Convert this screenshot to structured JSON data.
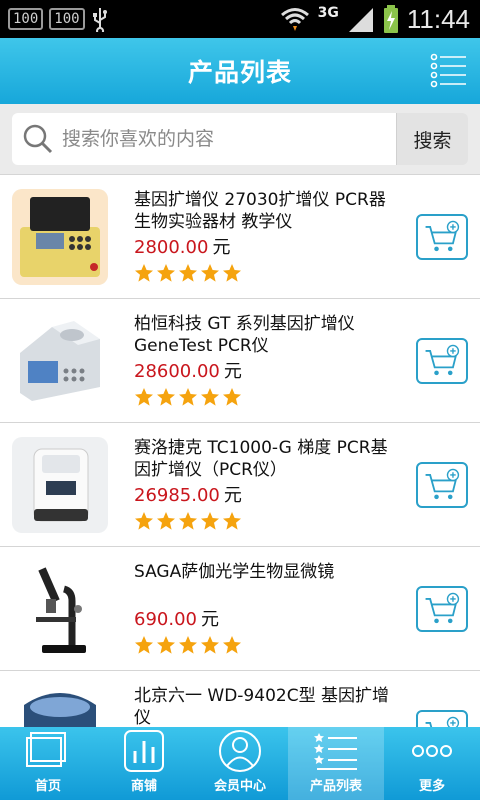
{
  "status_bar": {
    "left_boxes": [
      "100",
      "100"
    ],
    "network": "3G",
    "time": "11:44"
  },
  "header": {
    "title": "产品列表"
  },
  "search": {
    "placeholder": "搜索你喜欢的内容",
    "button_label": "搜索"
  },
  "products": [
    {
      "name": " 基因扩增仪 27030扩增仪 PCR器 生物实验器材 教学仪",
      "price": "2800.00",
      "unit": "元",
      "rating": 5
    },
    {
      "name": "柏恒科技 GT 系列基因扩增仪 GeneTest PCR仪",
      "price": "28600.00",
      "unit": "元",
      "rating": 5
    },
    {
      "name": "赛洛捷克 TC1000-G 梯度 PCR基因扩增仪（PCR仪）",
      "price": "26985.00",
      "unit": "元",
      "rating": 5
    },
    {
      "name": "SAGA萨伽光学生物显微镜",
      "price": "690.00",
      "unit": "元",
      "rating": 5
    },
    {
      "name": "北京六一 WD-9402C型 基因扩增仪",
      "price": "",
      "unit": "",
      "rating": 0
    }
  ],
  "tabs": [
    {
      "label": "首页",
      "icon": "home-icon"
    },
    {
      "label": "商铺",
      "icon": "shop-icon"
    },
    {
      "label": "会员中心",
      "icon": "member-icon"
    },
    {
      "label": "产品列表",
      "icon": "product-list-icon",
      "active": true
    },
    {
      "label": "更多",
      "icon": "more-icon"
    }
  ],
  "colors": {
    "primary": "#1aa9dc",
    "price": "#c9161d",
    "star": "#f5a30e"
  }
}
